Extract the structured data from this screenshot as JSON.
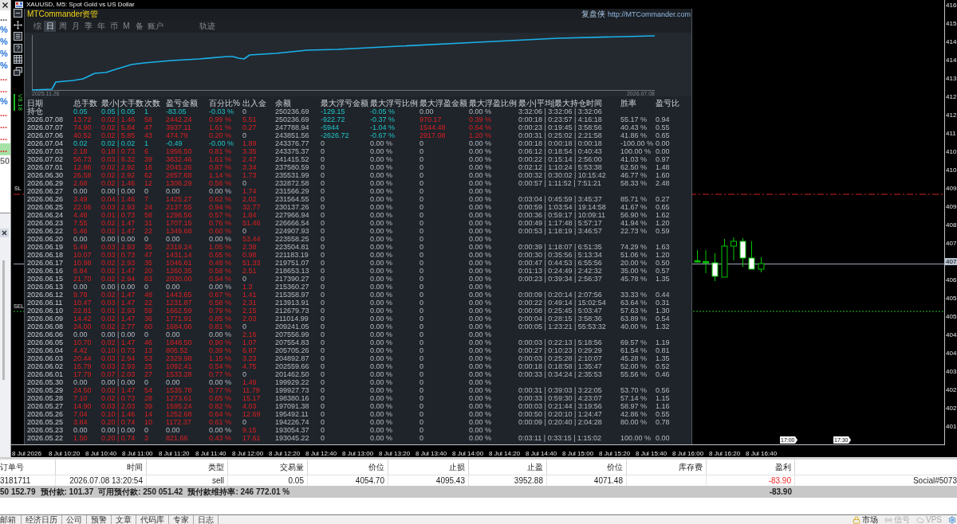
{
  "market_watch": {
    "items": [
      {
        "text": "...",
        "color": "#333333",
        "selected": false
      },
      {
        "text": "%",
        "color": "#1f6fd6",
        "selected": false
      },
      {
        "text": "%",
        "color": "#1f6fd6",
        "selected": false
      },
      {
        "text": "%",
        "color": "#1f6fd6",
        "selected": false
      },
      {
        "text": "%",
        "color": "#1f6fd6",
        "selected": false
      },
      {
        "text": "...",
        "color": "#e02020",
        "selected": false
      },
      {
        "text": "...",
        "color": "#e02020",
        "selected": false
      },
      {
        "text": "%",
        "color": "#1f6fd6",
        "selected": false
      },
      {
        "text": "...",
        "color": "#e02020",
        "selected": false
      },
      {
        "text": "...",
        "color": "#e02020",
        "selected": false
      },
      {
        "text": "...",
        "color": "#e02020",
        "selected": false
      },
      {
        "text": "...",
        "color": "#e02020",
        "selected": true
      },
      {
        "text": "50",
        "color": "#777777",
        "selected": false
      }
    ]
  },
  "chart": {
    "title": "XAUUSD, M5: Spot Gold vs US Dollar",
    "version_label": "V8.18",
    "level_labels": [
      "SL",
      "SEL"
    ],
    "price_axis": [
      {
        "label": "416",
        "current": false
      },
      {
        "label": "415",
        "current": false
      },
      {
        "label": "414",
        "current": false
      },
      {
        "label": "414",
        "current": false
      },
      {
        "label": "413",
        "current": false
      },
      {
        "label": "412",
        "current": false
      },
      {
        "label": "412",
        "current": false
      },
      {
        "label": "411",
        "current": false
      },
      {
        "label": "410",
        "current": false
      },
      {
        "label": "410",
        "current": false
      },
      {
        "label": "409",
        "current": false
      },
      {
        "label": "409",
        "current": false
      },
      {
        "label": "408",
        "current": false
      },
      {
        "label": "407",
        "current": false
      },
      {
        "label": "407",
        "current": true
      },
      {
        "label": "406",
        "current": false
      },
      {
        "label": "405",
        "current": false
      },
      {
        "label": "405",
        "current": false
      },
      {
        "label": "404",
        "current": false
      },
      {
        "label": "404",
        "current": false
      },
      {
        "label": "403",
        "current": false
      },
      {
        "label": "402",
        "current": false
      },
      {
        "label": "402",
        "current": false
      },
      {
        "label": "401",
        "current": false
      }
    ],
    "time_axis": [
      "8 Jul 2026",
      "8 Jul 10:20",
      "8 Jul 10:40",
      "8 Jul 11:00",
      "8 Jul 11:20",
      "8 Jul 11:40",
      "8 Jul 12:00",
      "8 Jul 12:20",
      "8 Jul 12:40",
      "8 Jul 13:00",
      "8 Jul 13:20",
      "8 Jul 13:40",
      "8 Jul 14:00",
      "8 Jul 14:20",
      "8 Jul 14:40",
      "8 Jul 15:00",
      "8 Jul 15:20",
      "8 Jul 15:40",
      "8 Jul 16:00",
      "8 Jul 16:20",
      "8 Jul 16:40"
    ],
    "time_flags": [
      "17:00",
      "17:30"
    ]
  },
  "commander_panel": {
    "title": "MTCommander资管",
    "site_label": "复盘侠",
    "site_url": "http://MTCommander.com",
    "tabs": [
      {
        "label": "综",
        "selected": false
      },
      {
        "label": "日",
        "selected": true
      },
      {
        "label": "周",
        "selected": false
      },
      {
        "label": "月",
        "selected": false
      },
      {
        "label": "季",
        "selected": false
      },
      {
        "label": "年",
        "selected": false
      },
      {
        "label": "币",
        "selected": false
      },
      {
        "label": "M",
        "selected": false
      },
      {
        "label": "备",
        "selected": false
      },
      {
        "label": "账户",
        "selected": false
      }
    ],
    "side_tabs": [
      {
        "label": "轨迹",
        "selected": false
      }
    ],
    "equity_curve": {
      "start_label": "2025.11.26",
      "end_label": "2026.07.08"
    },
    "table": {
      "columns": [
        "日期",
        "总手数",
        "最小|大手数",
        "次数",
        "盈亏金额",
        "百分比%",
        "出入金",
        "余额",
        "最大浮亏金额",
        "最大浮亏比例",
        "最大浮盈金额",
        "最大浮盈比例",
        "最小|平均|最大持仓时间",
        "胜率",
        "盈亏比"
      ],
      "rows": [
        {
          "cells": [
            "持仓",
            "0.05",
            "0.05 | 0.05",
            "1",
            "-83.05",
            "-0.03 %",
            "0",
            "250236.69",
            "-129.15",
            "-0.05 %",
            "0.00",
            "0.00 %",
            "3:32:06 | 3:32:06 | 3:32:06"
          ],
          "kind": "loss",
          "cash_moved": false,
          "float_loss": true,
          "float_profit": false
        },
        {
          "cells": [
            "2026.07.08",
            "13.72",
            "0.02 | 1.46",
            "58",
            "2442.24",
            "0.99 %",
            "5.51",
            "250236.69",
            "-922.72",
            "-0.37 %",
            "970.17",
            "0.39 %",
            "0:00:18 | 0:23:57 | 4:16:18",
            "55.17 %",
            "0.94"
          ],
          "kind": "profit",
          "cash_moved": true,
          "float_loss": true,
          "float_profit": true
        },
        {
          "cells": [
            "2026.07.07",
            "74.90",
            "0.02 | 5.84",
            "47",
            "3937.11",
            "1.61 %",
            "0.27",
            "247788.94",
            "-5944",
            "-1.04 %",
            "1544.48",
            "0.64 %",
            "0:00:23 | 0:19:45 | 3:58:56",
            "40.43 %",
            "0.55"
          ],
          "kind": "profit",
          "cash_moved": true,
          "float_loss": true,
          "float_profit": true
        },
        {
          "cells": [
            "2026.07.06",
            "40.52",
            "0.02 | 5.85",
            "43",
            "474.79",
            "0.20 %",
            "0",
            "243851.56",
            "-2626.72",
            "-0.67 %",
            "2917.08",
            "1.20 %",
            "0:00:31 | 0:25:02 | 2:21:58",
            "41.86 %",
            "0.65"
          ],
          "kind": "profit",
          "cash_moved": false,
          "float_loss": true,
          "float_profit": true
        },
        {
          "cells": [
            "2026.07.04",
            "0.02",
            "0.02 | 0.02",
            "1",
            "-0.49",
            "-0.00 %",
            "1.89",
            "243376.77",
            "0",
            "0.00 %",
            "0",
            "0.00 %",
            "0:00:18 | 0:00:18 | 0:00:18",
            "-100.00 %",
            "0.00"
          ],
          "kind": "loss",
          "cash_moved": true,
          "float_loss": false,
          "float_profit": false
        },
        {
          "cells": [
            "2026.07.03",
            "2.18",
            "0.18 | 0.73",
            "6",
            "1956.50",
            "0.81 %",
            "3.35",
            "243375.37",
            "0",
            "0.00 %",
            "0",
            "0.00 %",
            "0:06:12 | 0:18:54 | 0:40:43",
            "100.00 %",
            "0.00"
          ],
          "kind": "profit",
          "cash_moved": true,
          "float_loss": false,
          "float_profit": false
        },
        {
          "cells": [
            "2026.07.02",
            "56.73",
            "0.03 | 8.32",
            "39",
            "3832.46",
            "1.61 %",
            "2.47",
            "241415.52",
            "0",
            "0.00 %",
            "0",
            "0.00 %",
            "0:00:22 | 0:15:14 | 2:56:00",
            "41.03 %",
            "0.97"
          ],
          "kind": "profit",
          "cash_moved": true,
          "float_loss": false,
          "float_profit": false
        },
        {
          "cells": [
            "2026.07.01",
            "12.86",
            "0.02 | 2.92",
            "16",
            "2045.26",
            "0.87 %",
            "3.34",
            "237580.59",
            "0",
            "0.00 %",
            "0",
            "0.00 %",
            "0:02:12 | 1:10:24 | 5:53:38",
            "62.50 %",
            "1.48"
          ],
          "kind": "profit",
          "cash_moved": true,
          "float_loss": false,
          "float_profit": false
        },
        {
          "cells": [
            "2026.06.30",
            "26.58",
            "0.02 | 2.92",
            "62",
            "2657.68",
            "1.14 %",
            "1.73",
            "235531.99",
            "0",
            "0.00 %",
            "0",
            "0.00 %",
            "0:00:32 | 0:30:02 | 10:15:42",
            "46.77 %",
            "1.60"
          ],
          "kind": "profit",
          "cash_moved": true,
          "float_loss": false,
          "float_profit": false
        },
        {
          "cells": [
            "2026.06.29",
            "2.68",
            "0.02 | 1.46",
            "12",
            "1306.29",
            "0.56 %",
            "0",
            "232872.58",
            "0",
            "0.00 %",
            "0",
            "0.00 %",
            "0:00:57 | 1:11:52 | 7:51:21",
            "58.33 %",
            "2.48"
          ],
          "kind": "profit",
          "cash_moved": false,
          "float_loss": false,
          "float_profit": false
        },
        {
          "cells": [
            "2026.06.27",
            "0.00",
            "0.00 | 0.00",
            "0",
            "0.00",
            "0.00 %",
            "1.74",
            "231566.29",
            "0",
            "0.00 %",
            "0",
            "0.00 %"
          ],
          "kind": "flat",
          "cash_moved": true,
          "float_loss": false,
          "float_profit": false
        },
        {
          "cells": [
            "2026.06.26",
            "3.49",
            "0.04 | 1.46",
            "7",
            "1425.27",
            "0.62 %",
            "2.02",
            "231564.55",
            "0",
            "0.00 %",
            "0",
            "0.00 %",
            "0:03:04 | 0:45:59 | 3:45:37",
            "85.71 %",
            "0.27"
          ],
          "kind": "profit",
          "cash_moved": true,
          "float_loss": false,
          "float_profit": false
        },
        {
          "cells": [
            "2026.06.25",
            "22.06",
            "0.03 | 2.93",
            "24",
            "2137.55",
            "0.94 %",
            "32.77",
            "230137.26",
            "0",
            "0.00 %",
            "0",
            "0.00 %",
            "0:00:59 | 1:03:54 | 19:14:58",
            "41.67 %",
            "0.65"
          ],
          "kind": "profit",
          "cash_moved": true,
          "float_loss": false,
          "float_profit": false
        },
        {
          "cells": [
            "2026.06.24",
            "4.48",
            "0.01 | 0.73",
            "58",
            "1298.56",
            "0.57 %",
            "1.84",
            "227966.94",
            "0",
            "0.00 %",
            "0",
            "0.00 %",
            "0:00:36 | 0:59:17 | 10:09:11",
            "56.90 %",
            "1.62"
          ],
          "kind": "profit",
          "cash_moved": true,
          "float_loss": false,
          "float_profit": false
        },
        {
          "cells": [
            "2026.06.23",
            "7.55",
            "0.02 | 1.47",
            "31",
            "1707.15",
            "0.76 %",
            "51.46",
            "226666.54",
            "0",
            "0.00 %",
            "0",
            "0.00 %",
            "0:00:49 | 1:17:48 | 5:57:17",
            "41.94 %",
            "1.20"
          ],
          "kind": "profit",
          "cash_moved": true,
          "float_loss": false,
          "float_profit": false
        },
        {
          "cells": [
            "2026.06.22",
            "5.46",
            "0.02 | 1.47",
            "22",
            "1349.68",
            "0.60 %",
            "0",
            "224907.93",
            "0",
            "0.00 %",
            "0",
            "0.00 %",
            "0:00:53 | 1:18:19 | 3:46:57",
            "22.73 %",
            "0.59"
          ],
          "kind": "profit",
          "cash_moved": false,
          "float_loss": false,
          "float_profit": false
        },
        {
          "cells": [
            "2026.06.20",
            "0.00",
            "0.00 | 0.00",
            "0",
            "0.00",
            "0.00 %",
            "53.44",
            "223558.25",
            "0",
            "0.00 %",
            "0",
            "0.00 %"
          ],
          "kind": "flat",
          "cash_moved": true,
          "float_loss": false,
          "float_profit": false
        },
        {
          "cells": [
            "2026.06.19",
            "5.49",
            "0.03 | 2.93",
            "35",
            "2319.24",
            "1.05 %",
            "2.38",
            "223504.81",
            "0",
            "0.00 %",
            "0",
            "0.00 %",
            "0:00:39 | 1:18:07 | 6:51:35",
            "74.29 %",
            "1.63"
          ],
          "kind": "profit",
          "cash_moved": true,
          "float_loss": false,
          "float_profit": false
        },
        {
          "cells": [
            "2026.06.18",
            "10.07",
            "0.03 | 0.73",
            "47",
            "1431.14",
            "0.65 %",
            "0.98",
            "221183.19",
            "0",
            "0.00 %",
            "0",
            "0.00 %",
            "0:00:30 | 0:35:56 | 5:13:34",
            "51.06 %",
            "1.20"
          ],
          "kind": "profit",
          "cash_moved": true,
          "float_loss": false,
          "float_profit": false
        },
        {
          "cells": [
            "2026.06.17",
            "10.98",
            "0.02 | 2.93",
            "35",
            "1046.61",
            "0.48 %",
            "51.33",
            "219751.07",
            "0",
            "0.00 %",
            "0",
            "0.00 %",
            "0:00:47 | 0:44:53 | 6:55:56",
            "20.00 %",
            "0.50"
          ],
          "kind": "profit",
          "cash_moved": true,
          "float_loss": false,
          "float_profit": false
        },
        {
          "cells": [
            "2026.06.16",
            "8.84",
            "0.02 | 1.47",
            "20",
            "1260.35",
            "0.58 %",
            "2.51",
            "218653.13",
            "0",
            "0.00 %",
            "0",
            "0.00 %",
            "0:01:13 | 0:24:49 | 2:42:32",
            "35.00 %",
            "0.57"
          ],
          "kind": "profit",
          "cash_moved": true,
          "float_loss": false,
          "float_profit": false
        },
        {
          "cells": [
            "2026.06.15",
            "21.70",
            "0.02 | 2.94",
            "83",
            "2030.00",
            "0.94 %",
            "0",
            "217390.27",
            "0",
            "0.00 %",
            "0",
            "0.00 %",
            "0:00:23 | 0:39:34 | 2:56:37",
            "45.78 %",
            "1.35"
          ],
          "kind": "profit",
          "cash_moved": false,
          "float_loss": false,
          "float_profit": false
        },
        {
          "cells": [
            "2026.06.13",
            "0.00",
            "0.00 | 0.00",
            "0",
            "0.00",
            "0.00 %",
            "1.3",
            "215360.27",
            "0",
            "0.00 %",
            "0",
            "0.00 %"
          ],
          "kind": "flat",
          "cash_moved": true,
          "float_loss": false,
          "float_profit": false
        },
        {
          "cells": [
            "2026.06.12",
            "9.78",
            "0.02 | 1.47",
            "48",
            "1443.65",
            "0.67 %",
            "1.41",
            "215358.97",
            "0",
            "0.00 %",
            "0",
            "0.00 %",
            "0:00:09 | 0:20:14 | 2:07:56",
            "33.33 %",
            "0.44"
          ],
          "kind": "profit",
          "cash_moved": true,
          "float_loss": false,
          "float_profit": false
        },
        {
          "cells": [
            "2026.06.11",
            "10.47",
            "0.03 | 1.47",
            "22",
            "1231.87",
            "0.58 %",
            "2.31",
            "213913.91",
            "0",
            "0.00 %",
            "0",
            "0.00 %",
            "0:00:22 | 0:49:14 | 15:02:54",
            "63.64 %",
            "0.31"
          ],
          "kind": "profit",
          "cash_moved": true,
          "float_loss": false,
          "float_profit": false
        },
        {
          "cells": [
            "2026.06.10",
            "22.81",
            "0.01 | 2.93",
            "59",
            "1662.59",
            "0.79 %",
            "2.15",
            "212679.73",
            "0",
            "0.00 %",
            "0",
            "0.00 %",
            "0:00:08 | 0:25:45 | 5:03:47",
            "57.63 %",
            "1.30"
          ],
          "kind": "profit",
          "cash_moved": true,
          "float_loss": false,
          "float_profit": false
        },
        {
          "cells": [
            "2026.06.09",
            "14.42",
            "0.02 | 1.47",
            "36",
            "1771.91",
            "0.85 %",
            "2.03",
            "211014.99",
            "0",
            "0.00 %",
            "0",
            "0.00 %",
            "0:00:04 | 0:28:15 | 3:58:36",
            "63.89 %",
            "0.54"
          ],
          "kind": "profit",
          "cash_moved": true,
          "float_loss": false,
          "float_profit": false
        },
        {
          "cells": [
            "2026.06.08",
            "24.00",
            "0.02 | 2.77",
            "60",
            "1684.06",
            "0.81 %",
            "0",
            "209241.05",
            "0",
            "0.00 %",
            "0",
            "0.00 %",
            "0:00:05 | 1:23:21 | 55:53:32",
            "40.00 %",
            "1.32"
          ],
          "kind": "profit",
          "cash_moved": false,
          "float_loss": false,
          "float_profit": false
        },
        {
          "cells": [
            "2026.06.06",
            "0.00",
            "0.00 | 0.00",
            "0",
            "0.00",
            "0.00 %",
            "2.16",
            "207556.99",
            "0",
            "0.00 %",
            "0",
            "0.00 %"
          ],
          "kind": "flat",
          "cash_moved": true,
          "float_loss": false,
          "float_profit": false
        },
        {
          "cells": [
            "2026.06.05",
            "10.70",
            "0.02 | 1.47",
            "46",
            "1848.50",
            "0.90 %",
            "1.07",
            "207554.83",
            "0",
            "0.00 %",
            "0",
            "0.00 %",
            "0:00:03 | 0:22:13 | 5:18:56",
            "69.57 %",
            "1.19"
          ],
          "kind": "profit",
          "cash_moved": true,
          "float_loss": false,
          "float_profit": false
        },
        {
          "cells": [
            "2026.06.04",
            "4.42",
            "0.10 | 0.73",
            "13",
            "805.52",
            "0.39 %",
            "6.87",
            "205705.26",
            "0",
            "0.00 %",
            "0",
            "0.00 %",
            "0:00:27 | 0:10:23 | 0:29:29",
            "61.54 %",
            "0.81"
          ],
          "kind": "profit",
          "cash_moved": true,
          "float_loss": false,
          "float_profit": false
        },
        {
          "cells": [
            "2026.06.03",
            "20.44",
            "0.03 | 2.94",
            "53",
            "2329.98",
            "1.15 %",
            "3.23",
            "204892.87",
            "0",
            "0.00 %",
            "0",
            "0.00 %",
            "0:00:03 | 0:25:28 | 2:10:07",
            "45.28 %",
            "1.35"
          ],
          "kind": "profit",
          "cash_moved": true,
          "float_loss": false,
          "float_profit": false
        },
        {
          "cells": [
            "2026.06.02",
            "15.79",
            "0.03 | 2.93",
            "25",
            "1092.41",
            "0.54 %",
            "4.75",
            "202559.66",
            "0",
            "0.00 %",
            "0",
            "0.00 %",
            "0:00:18 | 0:18:58 | 1:35:47",
            "52.00 %",
            "0.52"
          ],
          "kind": "profit",
          "cash_moved": true,
          "float_loss": false,
          "float_profit": false
        },
        {
          "cells": [
            "2026.06.01",
            "17.79",
            "0.07 | 2.03",
            "27",
            "1533.28",
            "0.77 %",
            "0",
            "201462.50",
            "0",
            "0.00 %",
            "0",
            "0.00 %",
            "0:00:33 | 0:34:24 | 2:35:53",
            "55.56 %",
            "0.46"
          ],
          "kind": "profit",
          "cash_moved": false,
          "float_loss": false,
          "float_profit": false
        },
        {
          "cells": [
            "2026.05.30",
            "0.00",
            "0.00 | 0.00",
            "0",
            "0.00",
            "0.00 %",
            "1.49",
            "199929.22",
            "0",
            "0.00 %",
            "0",
            "0.00 %"
          ],
          "kind": "flat",
          "cash_moved": true,
          "float_loss": false,
          "float_profit": false
        },
        {
          "cells": [
            "2026.05.29",
            "24.50",
            "0.02 | 1.47",
            "54",
            "1535.78",
            "0.77 %",
            "11.79",
            "199927.73",
            "0",
            "0.00 %",
            "0",
            "0.00 %",
            "0:00:31 | 0:39:03 | 3:22:05",
            "53.70 %",
            "0.56"
          ],
          "kind": "profit",
          "cash_moved": true,
          "float_loss": false,
          "float_profit": false
        },
        {
          "cells": [
            "2026.05.28",
            "7.10",
            "0.02 | 0.73",
            "28",
            "1273.61",
            "0.65 %",
            "15.17",
            "198380.16",
            "0",
            "0.00 %",
            "0",
            "0.00 %",
            "0:00:33 | 0:59:30 | 4:23:07",
            "57.14 %",
            "1.15"
          ],
          "kind": "profit",
          "cash_moved": true,
          "float_loss": false,
          "float_profit": false
        },
        {
          "cells": [
            "2026.05.27",
            "14.90",
            "0.03 | 2.03",
            "39",
            "1595.24",
            "0.82 %",
            "4.03",
            "197091.38",
            "0",
            "0.00 %",
            "0",
            "0.00 %",
            "0:00:03 | 0:21:44 | 3:19:56",
            "58.97 %",
            "1.16"
          ],
          "kind": "profit",
          "cash_moved": true,
          "float_loss": false,
          "float_profit": false
        },
        {
          "cells": [
            "2026.05.26",
            "7.04",
            "0.10 | 1.46",
            "14",
            "1252.68",
            "0.64 %",
            "12.69",
            "195492.11",
            "0",
            "0.00 %",
            "0",
            "0.00 %",
            "0:00:50 | 0:20:10 | 1:24:47",
            "42.86 %",
            "0.55"
          ],
          "kind": "profit",
          "cash_moved": true,
          "float_loss": false,
          "float_profit": false
        },
        {
          "cells": [
            "2026.05.25",
            "3.84",
            "0.20 | 0.74",
            "10",
            "1172.37",
            "0.61 %",
            "0",
            "194226.74",
            "0",
            "0.00 %",
            "0",
            "0.00 %",
            "0:00:09 | 0:20:40 | 2:04:28",
            "80.00 %",
            "0.78"
          ],
          "kind": "profit",
          "cash_moved": false,
          "float_loss": false,
          "float_profit": false
        },
        {
          "cells": [
            "2026.05.23",
            "0.00",
            "0.00 | 0.00",
            "0",
            "0.00",
            "0.00 %",
            "9.15",
            "193054.37",
            "0",
            "0.00 %",
            "0",
            "0.00 %"
          ],
          "kind": "flat",
          "cash_moved": true,
          "float_loss": false,
          "float_profit": false
        },
        {
          "cells": [
            "2026.05.22",
            "1.50",
            "0.20 | 0.74",
            "3",
            "821.66",
            "0.43 %",
            "17.61",
            "193045.22",
            "0",
            "0.00 %",
            "0",
            "0.00 %",
            "0:03:11 | 0:33:15 | 1:15:02",
            "100.00 %",
            "0.00"
          ],
          "kind": "profit",
          "cash_moved": true,
          "float_loss": false,
          "float_profit": false
        }
      ]
    }
  },
  "toolbox": {
    "columns": [
      "订单号",
      "时间",
      "类型",
      "交易量",
      "价位",
      "止损",
      "止盈",
      "价位",
      "库存费",
      "盈利"
    ],
    "rows": [
      {
        "cells": [
          "3181711",
          "2026.07.08 13:20:54",
          "sell",
          "0.05",
          "4054.70",
          "4095.43",
          "3952.88",
          "4071.48"
        ],
        "profit": "-83.90",
        "negative": true,
        "comment": "Social#5073"
      }
    ],
    "summary": {
      "figures": [
        "50 152.79",
        "预付款: 101.37",
        "可用预付款: 250 051.42",
        "预付款维持率: 246 772.01 %"
      ],
      "total_profit": "-83.90"
    },
    "bottom_tabs": [
      "邮箱",
      "经济日历",
      "公司",
      "预警",
      "文章",
      "代码库",
      "专家",
      "日志"
    ],
    "status_items": [
      {
        "label": "市场",
        "disabled": false
      },
      {
        "label": "信号",
        "disabled": true
      },
      {
        "label": "VPS",
        "disabled": true
      }
    ]
  }
}
